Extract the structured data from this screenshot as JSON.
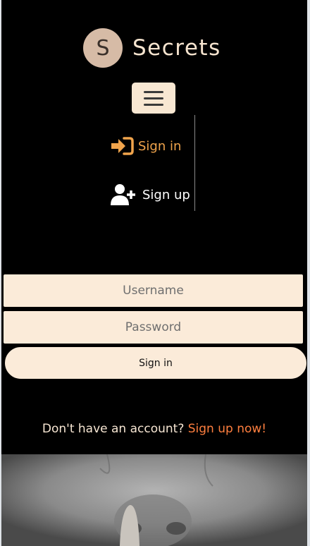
{
  "brand": {
    "logo_letter": "S",
    "name": "Secrets"
  },
  "nav": {
    "menu_icon": "hamburger-menu-icon",
    "items": [
      {
        "label": "Sign in",
        "icon": "sign-in-icon",
        "color": "#f0a44c"
      },
      {
        "label": "Sign up",
        "icon": "user-plus-icon",
        "color": "#ffffff"
      }
    ]
  },
  "form": {
    "username_placeholder": "Username",
    "password_placeholder": "Password",
    "submit_label": "Sign in"
  },
  "signup_prompt": {
    "text": "Don't have an account? ",
    "link": "Sign up now!"
  },
  "colors": {
    "background": "#000000",
    "accent": "#f0a44c",
    "link": "#ff7f3f",
    "cream": "#fbebd9"
  }
}
